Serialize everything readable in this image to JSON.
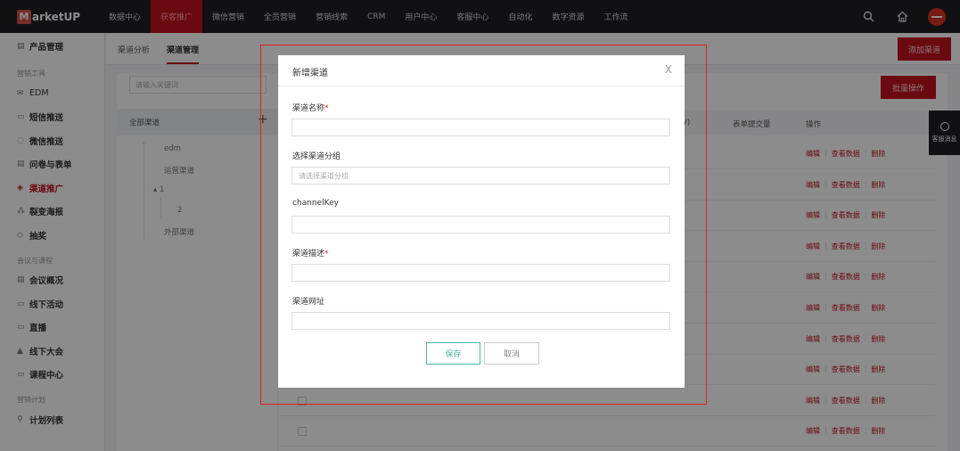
{
  "brand": {
    "mark": "M",
    "name": "arketUP"
  },
  "nav": {
    "items": [
      "数据中心",
      "获客推广",
      "微信营销",
      "全员营销",
      "营销线索",
      "CRM",
      "用户中心",
      "客服中心",
      "自动化",
      "数字资源",
      "工作流"
    ],
    "active": "获客推广",
    "search_icon": "search-icon",
    "home_icon": "home-icon"
  },
  "sidebar": {
    "product": "产品管理",
    "section_tools": "营销工具",
    "tools": [
      "EDM",
      "短信推送",
      "微信推送",
      "问卷与表单",
      "渠道推广",
      "裂变海报",
      "抽奖"
    ],
    "active_tool": "渠道推广",
    "section_meeting": "会议与课程",
    "meeting": [
      "会议概况",
      "线下活动",
      "直播",
      "线下大会",
      "课程中心"
    ],
    "section_plan": "营销计划",
    "plan": [
      "计划列表"
    ]
  },
  "tabs": {
    "analysis": "渠道分析",
    "manage": "渠道管理"
  },
  "buttons": {
    "add_channel": "添加渠道",
    "batch": "批量操作"
  },
  "search": {
    "placeholder": "请输入关键词"
  },
  "tree": {
    "head": "全部渠道",
    "items": [
      "edm",
      "运营渠道",
      "1",
      "2",
      "外部渠道"
    ]
  },
  "table": {
    "headers": [
      "V)",
      "表单提交量",
      "操作"
    ],
    "ops": [
      "编辑",
      "查看数据",
      "删除"
    ],
    "row_count": 10
  },
  "modal": {
    "title": "新增渠道",
    "close": "X",
    "fields": [
      {
        "label": "渠道名称",
        "required": true,
        "placeholder": ""
      },
      {
        "label": "选择渠道分组",
        "required": false,
        "placeholder": "请选择渠道分组"
      },
      {
        "label": "channelKey",
        "required": false,
        "placeholder": ""
      },
      {
        "label": "渠道描述",
        "required": true,
        "placeholder": ""
      },
      {
        "label": "渠道网址",
        "required": false,
        "placeholder": ""
      }
    ],
    "save": "保存",
    "cancel": "取消"
  },
  "float": {
    "label": "客服消息"
  },
  "colors": {
    "brand_red": "#c4121f",
    "save_teal": "#45b8a8",
    "nav_bg": "#1f2024"
  }
}
